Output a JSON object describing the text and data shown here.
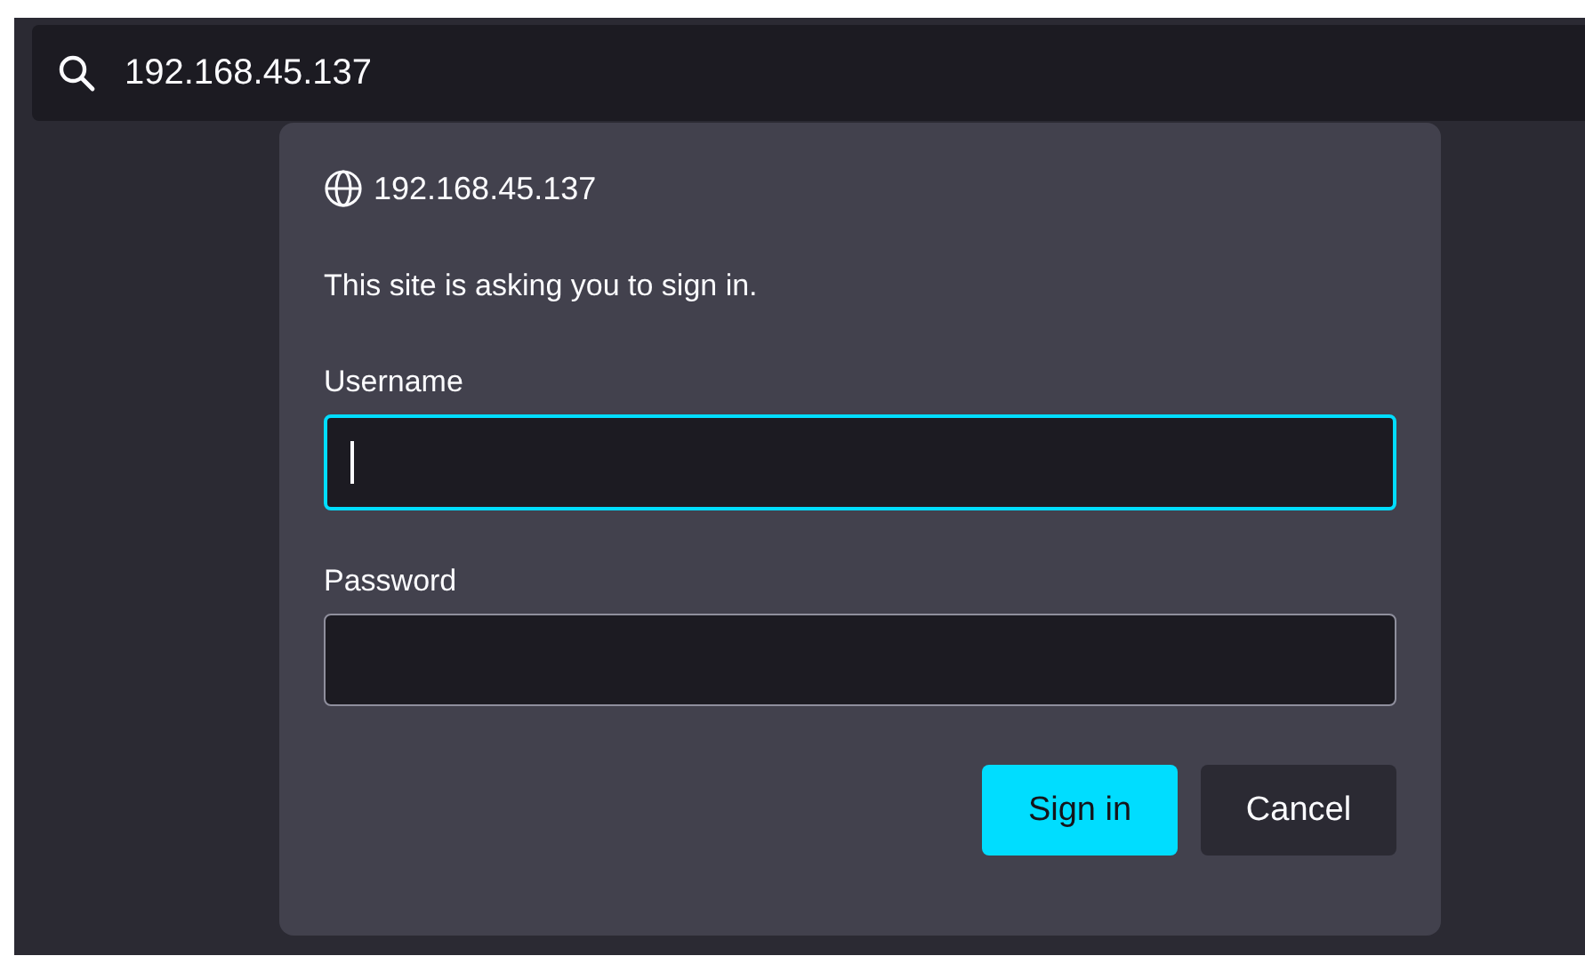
{
  "address_bar": {
    "value": "192.168.45.137"
  },
  "dialog": {
    "host": "192.168.45.137",
    "message": "This site is asking you to sign in.",
    "fields": [
      {
        "label": "Username",
        "focused": true
      },
      {
        "label": "Password",
        "focused": false
      }
    ],
    "buttons": [
      {
        "label": "Sign in",
        "kind": "primary"
      },
      {
        "label": "Cancel",
        "kind": "secondary"
      }
    ]
  }
}
